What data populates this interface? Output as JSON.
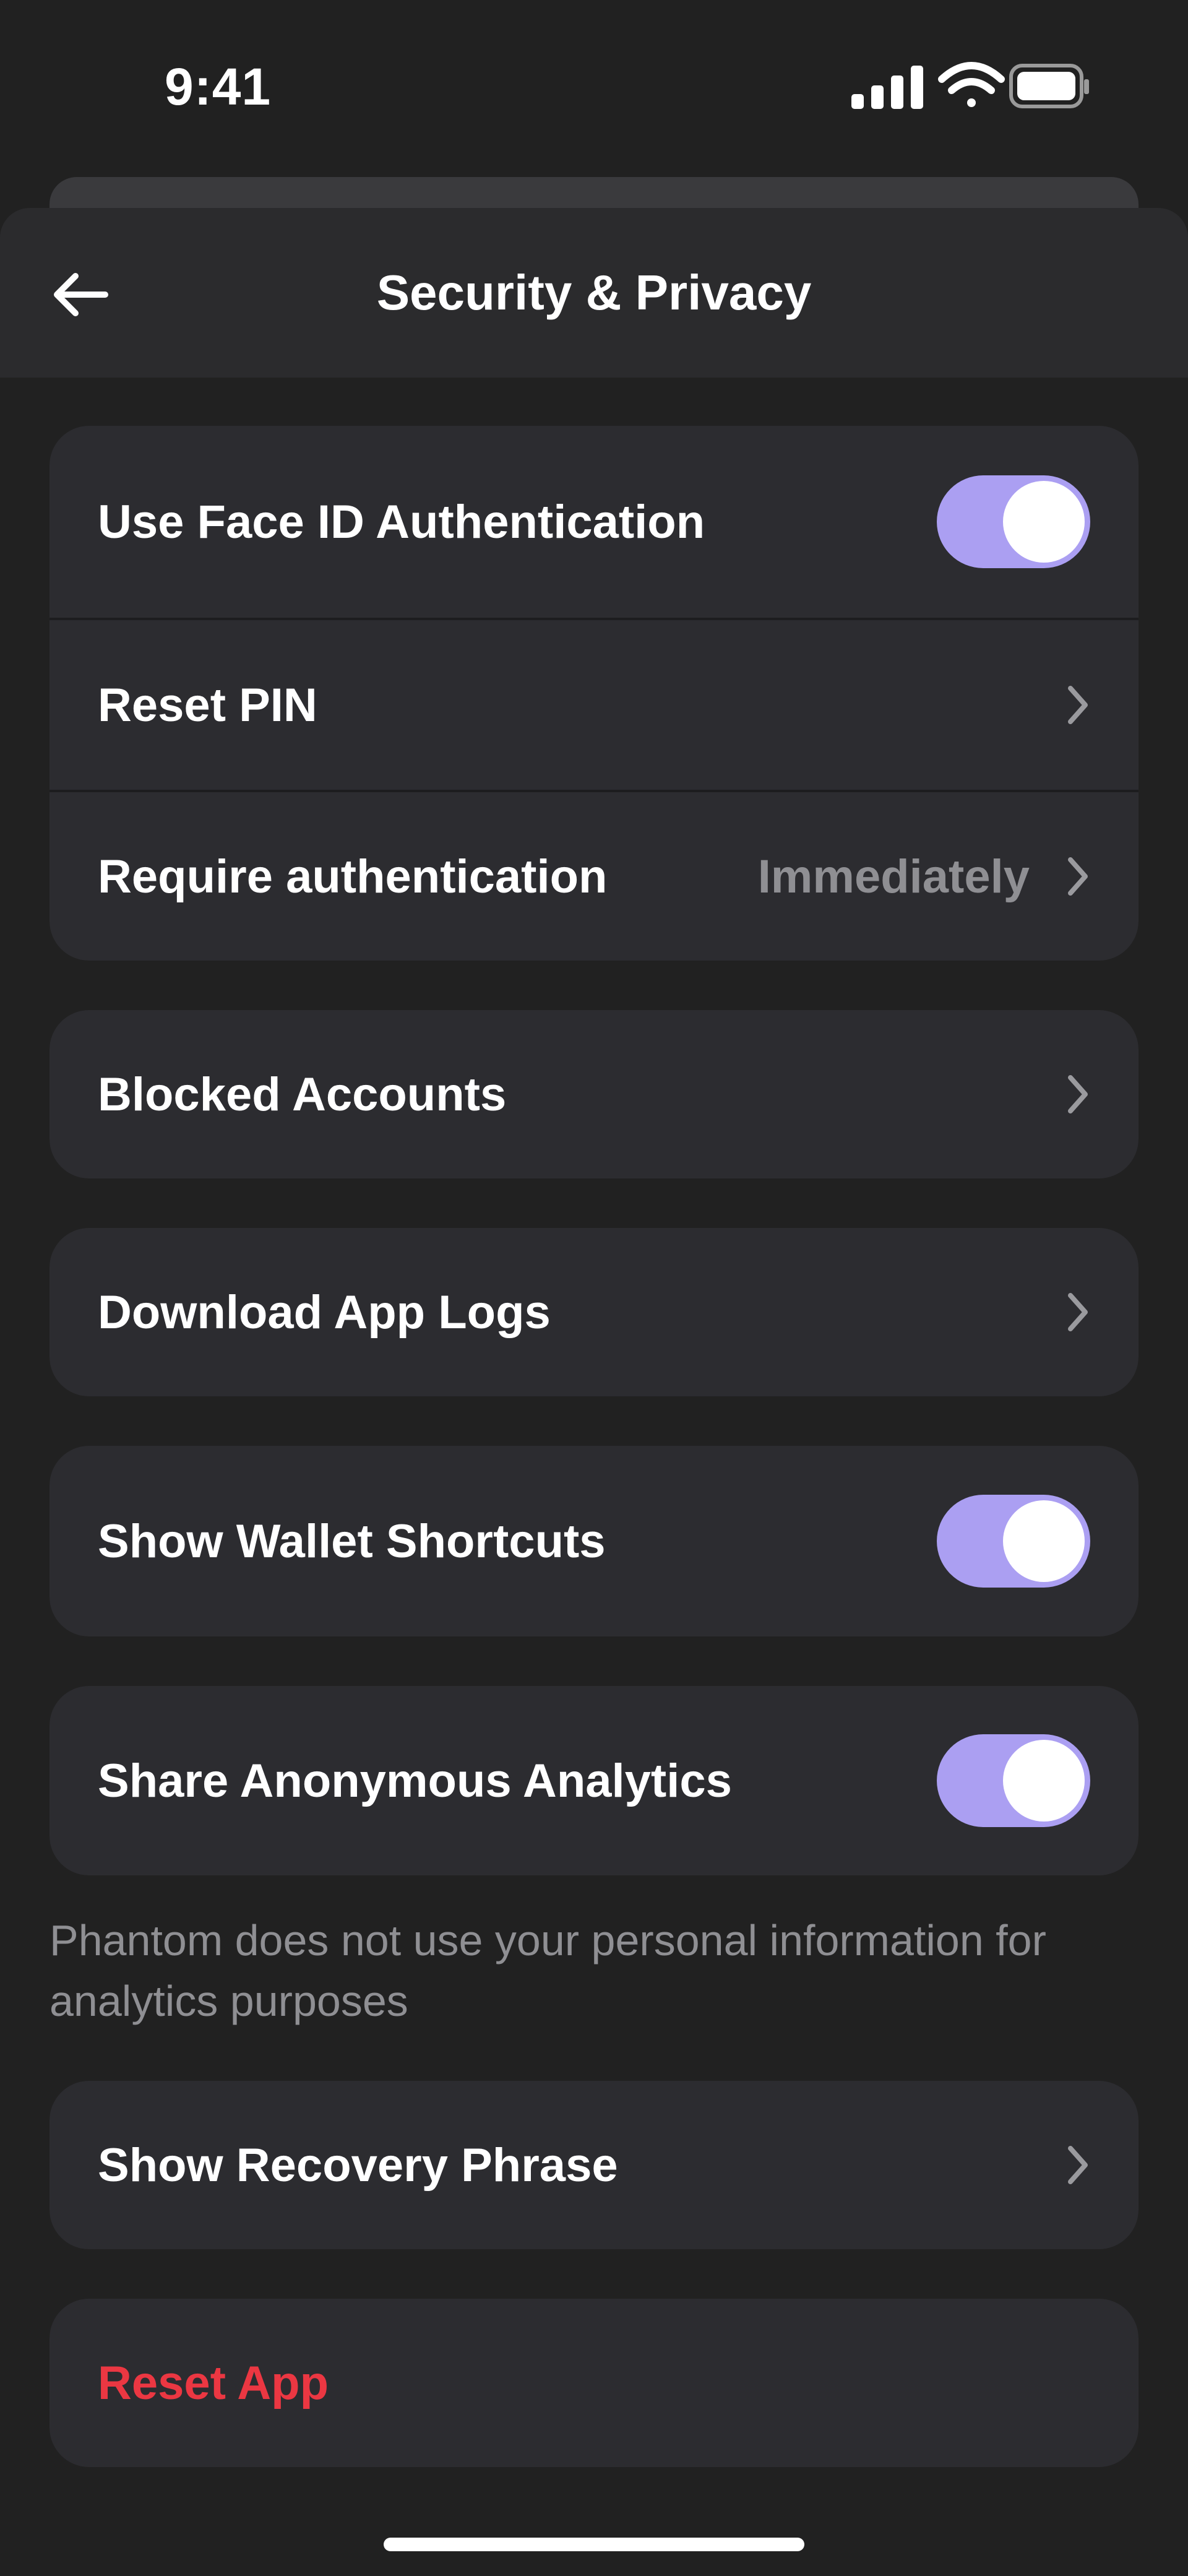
{
  "status_bar": {
    "time": "9:41",
    "icons": [
      "cellular-signal-icon",
      "wifi-icon",
      "battery-icon"
    ]
  },
  "nav": {
    "title": "Security & Privacy",
    "back_icon": "arrow-left-icon"
  },
  "sections": {
    "auth": {
      "face_id": {
        "label": "Use Face ID Authentication",
        "enabled": true
      },
      "reset_pin": {
        "label": "Reset PIN"
      },
      "require_auth": {
        "label": "Require authentication",
        "value": "Immediately"
      }
    },
    "blocked_accounts": {
      "label": "Blocked Accounts"
    },
    "download_logs": {
      "label": "Download App Logs"
    },
    "wallet_shortcuts": {
      "label": "Show Wallet Shortcuts",
      "enabled": true
    },
    "analytics": {
      "label": "Share Anonymous Analytics",
      "enabled": true,
      "helper": "Phantom does not use your personal information for analytics purposes"
    },
    "recovery_phrase": {
      "label": "Show Recovery Phrase"
    },
    "reset_app": {
      "label": "Reset App"
    }
  },
  "colors": {
    "background": "#212121",
    "card": "#2c2c30",
    "toggle_on": "#ab9ff2",
    "secondary_text": "#8f8f93",
    "danger": "#eb3742"
  }
}
